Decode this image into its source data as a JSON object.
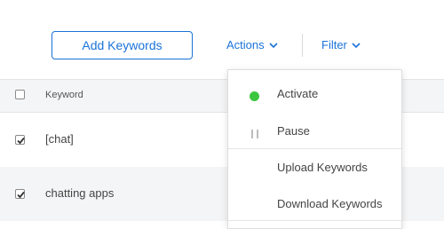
{
  "toolbar": {
    "add_keywords_label": "Add Keywords",
    "actions_label": "Actions",
    "filter_label": "Filter"
  },
  "table": {
    "columns": {
      "keyword": "Keyword"
    },
    "rows": [
      {
        "keyword": "[chat]",
        "checked": true
      },
      {
        "keyword": "chatting apps",
        "checked": true
      }
    ]
  },
  "actions_menu": {
    "items": [
      {
        "label": "Activate",
        "icon": "green-dot-icon"
      },
      {
        "label": "Pause",
        "icon": "pause-icon"
      },
      {
        "label": "Upload Keywords"
      },
      {
        "label": "Download Keywords"
      }
    ]
  },
  "colors": {
    "accent": "#1a73d9",
    "active_green": "#3cc640",
    "row_alt_bg": "#f4f5f6"
  }
}
